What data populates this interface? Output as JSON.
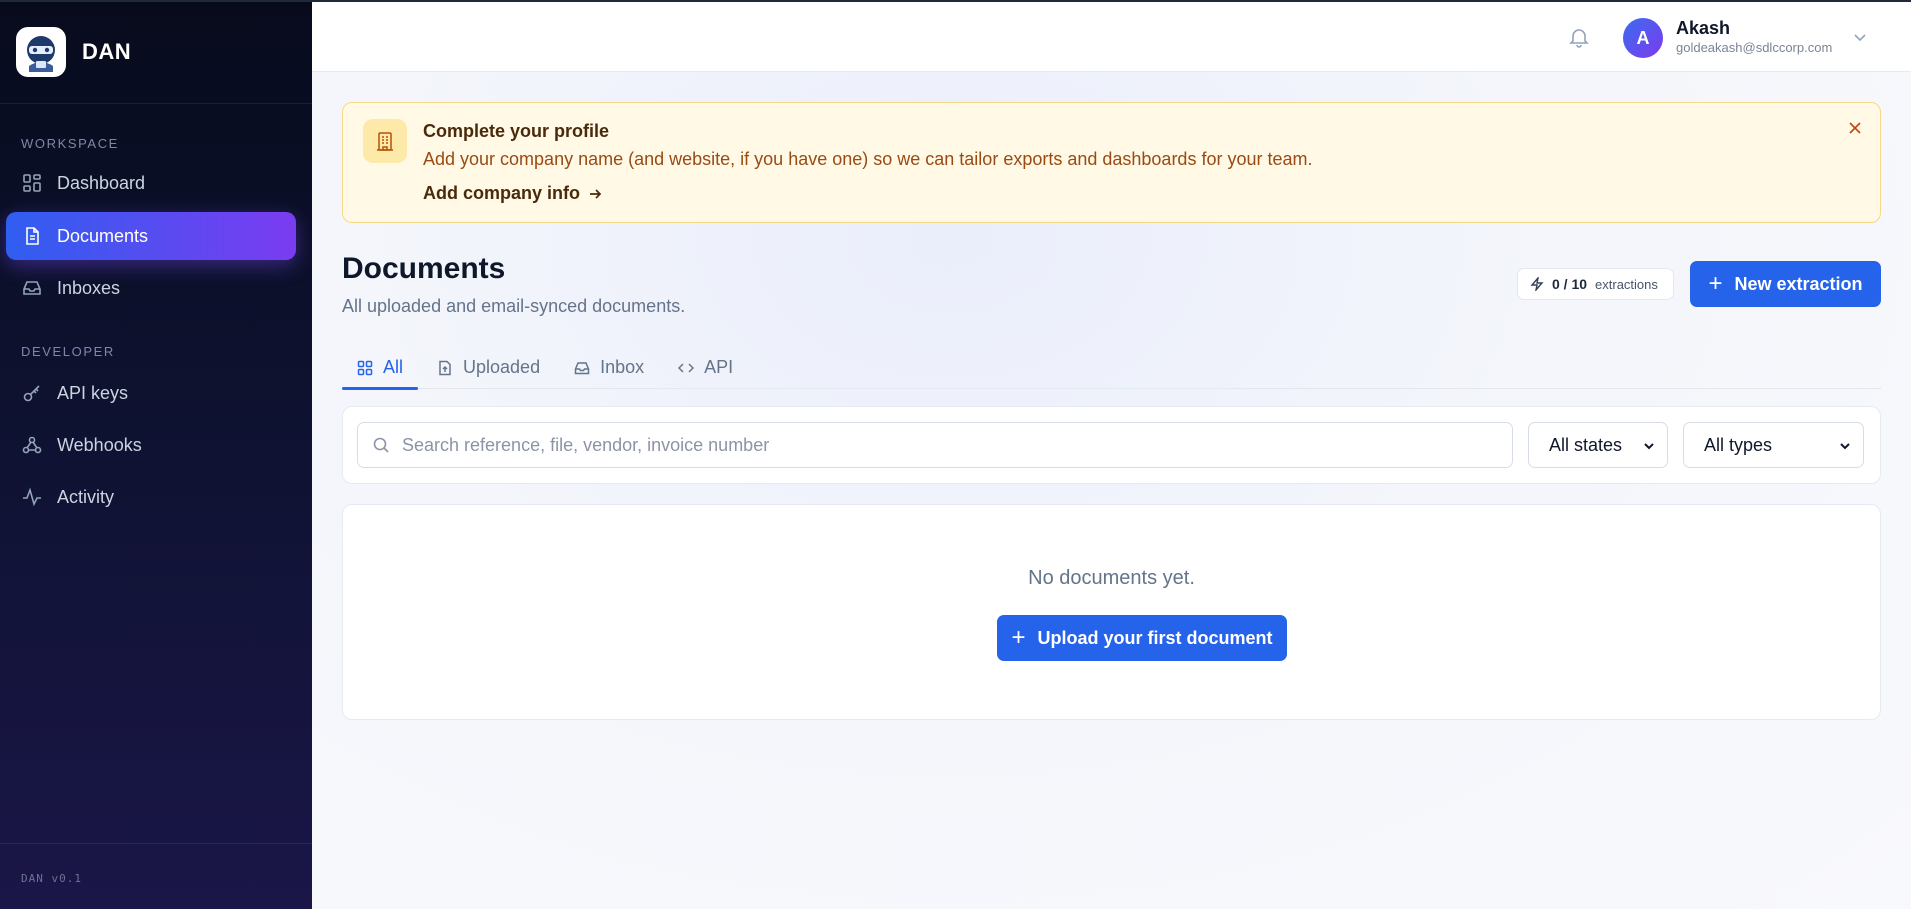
{
  "brand": {
    "name": "DAN",
    "version": "DAN v0.1"
  },
  "sidebar": {
    "sections": [
      {
        "label": "WORKSPACE",
        "items": [
          {
            "label": "Dashboard",
            "icon": "dashboard-icon"
          },
          {
            "label": "Documents",
            "icon": "document-icon",
            "active": true
          },
          {
            "label": "Inboxes",
            "icon": "inbox-icon"
          }
        ]
      },
      {
        "label": "DEVELOPER",
        "items": [
          {
            "label": "API keys",
            "icon": "key-icon"
          },
          {
            "label": "Webhooks",
            "icon": "webhook-icon"
          },
          {
            "label": "Activity",
            "icon": "activity-icon"
          }
        ]
      }
    ]
  },
  "user": {
    "initial": "A",
    "name": "Akash",
    "email": "goldeakash@sdlccorp.com"
  },
  "banner": {
    "title": "Complete your profile",
    "text": "Add your company name (and website, if you have one) so we can tailor exports and dashboards for your team.",
    "link": "Add company info"
  },
  "page": {
    "title": "Documents",
    "subtitle": "All uploaded and email-synced documents."
  },
  "quota": {
    "count": "0 / 10",
    "unit": "extractions"
  },
  "actions": {
    "new_extraction": "New extraction"
  },
  "tabs": [
    {
      "label": "All",
      "icon": "grid-icon",
      "active": true
    },
    {
      "label": "Uploaded",
      "icon": "file-upload-icon"
    },
    {
      "label": "Inbox",
      "icon": "inbox-icon"
    },
    {
      "label": "API",
      "icon": "code-icon"
    }
  ],
  "filters": {
    "search_placeholder": "Search reference, file, vendor, invoice number",
    "state_select": "All states",
    "type_select": "All types"
  },
  "empty": {
    "text": "No documents yet.",
    "button": "Upload your first document"
  },
  "colors": {
    "accent": "#2563eb",
    "sidebar_active_from": "#2f5ef0",
    "sidebar_active_to": "#7b3cf0",
    "banner_bg": "#fff9e6"
  }
}
